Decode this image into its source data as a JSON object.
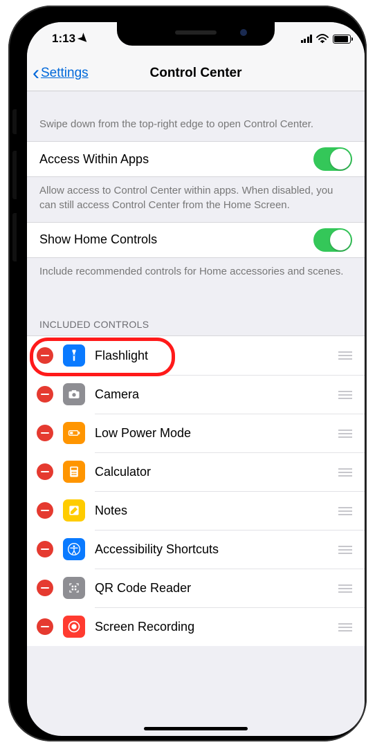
{
  "statusbar": {
    "time": "1:13"
  },
  "nav": {
    "back": "Settings",
    "title": "Control Center"
  },
  "sections": {
    "intro": "Swipe down from the top-right edge to open Control Center.",
    "access_label": "Access Within Apps",
    "access_footer": "Allow access to Control Center within apps. When disabled, you can still access Control Center from the Home Screen.",
    "home_label": "Show Home Controls",
    "home_footer": "Include recommended controls for Home accessories and scenes.",
    "included_header": "INCLUDED CONTROLS"
  },
  "toggles": {
    "access_within_apps": true,
    "show_home_controls": true
  },
  "included": [
    {
      "name": "Flashlight",
      "icon": "flashlight",
      "bg": "ic-blue"
    },
    {
      "name": "Camera",
      "icon": "camera",
      "bg": "ic-gray"
    },
    {
      "name": "Low Power Mode",
      "icon": "battery",
      "bg": "ic-orange"
    },
    {
      "name": "Calculator",
      "icon": "calculator",
      "bg": "ic-orange"
    },
    {
      "name": "Notes",
      "icon": "notes",
      "bg": "ic-yellow"
    },
    {
      "name": "Accessibility Shortcuts",
      "icon": "accessibility",
      "bg": "ic-blue"
    },
    {
      "name": "QR Code Reader",
      "icon": "qr",
      "bg": "ic-darkgray"
    },
    {
      "name": "Screen Recording",
      "icon": "record",
      "bg": "ic-red"
    }
  ],
  "highlight_index": 0
}
